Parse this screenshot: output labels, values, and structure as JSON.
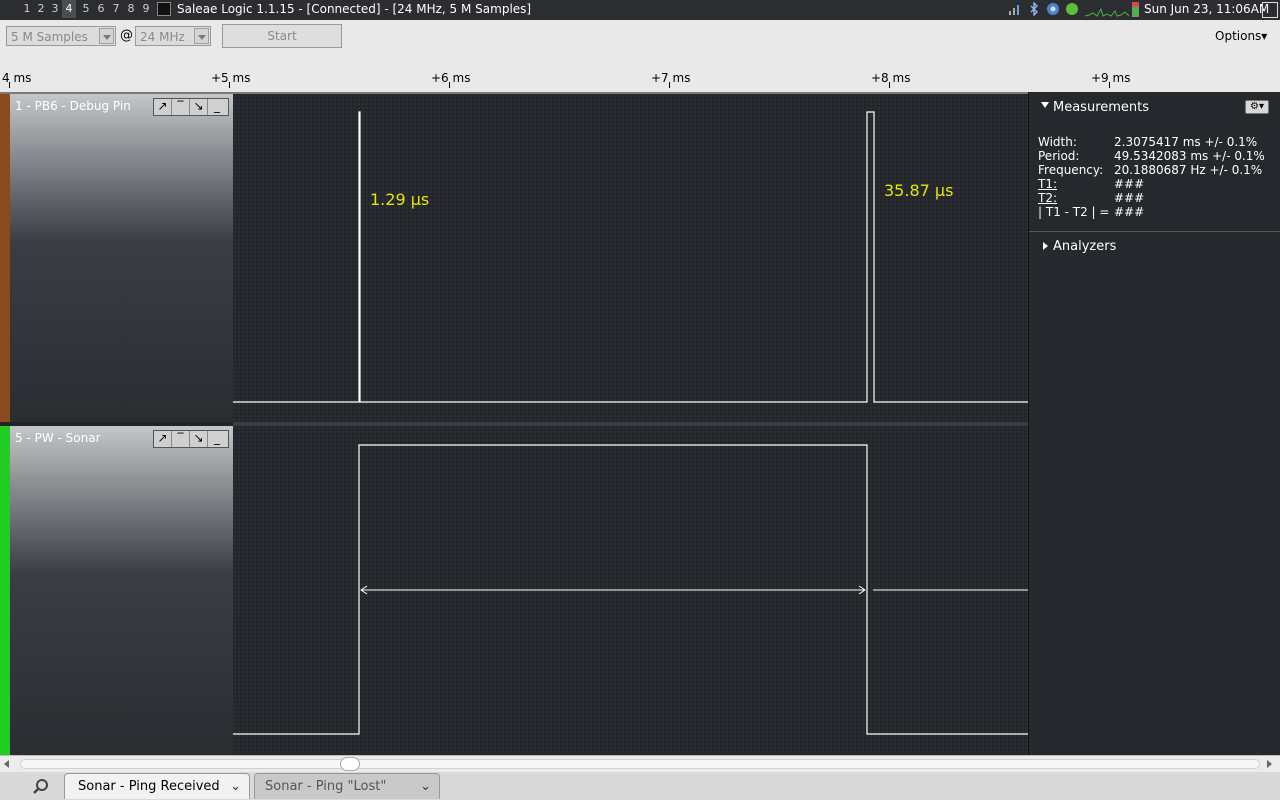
{
  "system": {
    "workspaces": [
      "1",
      "2",
      "3",
      "4",
      "5",
      "6",
      "7",
      "8",
      "9"
    ],
    "active_workspace": "4",
    "window_title": "Saleae Logic 1.1.15 - [Connected] - [24 MHz, 5 M Samples]",
    "clock": "Sun Jun 23, 11:06AM"
  },
  "toolbar": {
    "samples_value": "5 M Samples",
    "at_symbol": "@",
    "rate_value": "24 MHz",
    "start_label": "Start",
    "options_label": "Options▾"
  },
  "ruler": {
    "ticks": [
      "4 ms",
      "+5 ms",
      "+6 ms",
      "+7 ms",
      "+8 ms",
      "+9 ms"
    ]
  },
  "channels": [
    {
      "name": "1 - PB6 - Debug Pin",
      "color": "#8a4a1e",
      "measure_a": "1.29 µs",
      "measure_b": "35.87 µs"
    },
    {
      "name": "5 - PW - Sonar",
      "color": "#22cc22"
    }
  ],
  "trigger_icons": [
    "rising-edge-icon",
    "high-level-icon",
    "falling-edge-icon",
    "low-level-icon"
  ],
  "measurements": {
    "header": "Measurements",
    "rows": [
      {
        "label": "Width:",
        "value": "2.3075417 ms +/- 0.1%"
      },
      {
        "label": "Period:",
        "value": "49.5342083 ms +/- 0.1%"
      },
      {
        "label": "Frequency:",
        "value": "20.1880687 Hz +/- 0.1%"
      },
      {
        "label": "T1:",
        "value": "###"
      },
      {
        "label": "T2:",
        "value": "###"
      },
      {
        "label": "| T1 - T2 | =",
        "value": "###"
      }
    ]
  },
  "analyzers_header": "Analyzers",
  "tabs": [
    {
      "label": "Sonar - Ping Received"
    },
    {
      "label": "Sonar - Ping \"Lost\""
    }
  ]
}
